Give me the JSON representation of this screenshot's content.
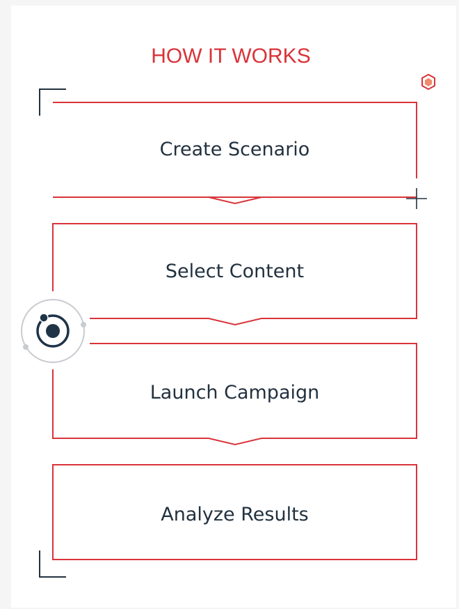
{
  "header": {
    "title": "HOW IT WORKS"
  },
  "steps": [
    {
      "label": "Create Scenario"
    },
    {
      "label": "Select Content"
    },
    {
      "label": "Launch Campaign"
    },
    {
      "label": "Analyze Results"
    }
  ],
  "colors": {
    "accent": "#d9333a",
    "text": "#22313f",
    "orb": "#1f3447",
    "decor": "#c8cbcf"
  },
  "icons": [
    "corner-bracket-icon",
    "hexagon-icon",
    "crosshair-plus-icon",
    "orbit-icon"
  ]
}
